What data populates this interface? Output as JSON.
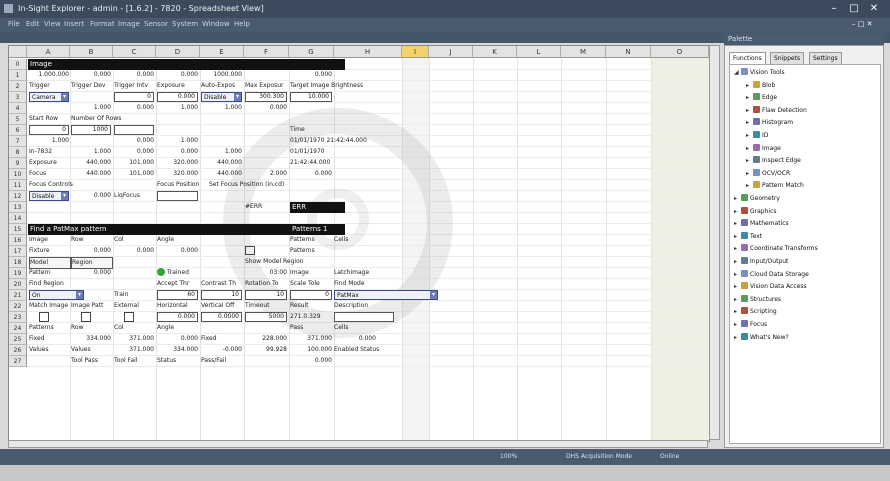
{
  "window": {
    "title": "In-Sight Explorer - admin - [1.6.2] - 7820 - Spreadsheet View]",
    "controls": [
      "–",
      "□",
      "✕"
    ]
  },
  "menu": [
    "File",
    "Edit",
    "View",
    "Insert",
    "Format",
    "Image",
    "Sensor",
    "System",
    "Window",
    "Help"
  ],
  "columns": [
    "A",
    "B",
    "C",
    "D",
    "E",
    "F",
    "G",
    "H",
    "I",
    "J",
    "K",
    "L",
    "M",
    "N",
    "O"
  ],
  "rows": [
    "0",
    "1",
    "2",
    "3",
    "4",
    "5",
    "6",
    "7",
    "8",
    "9",
    "10",
    "11",
    "12",
    "13",
    "14",
    "15",
    "16",
    "17",
    "18",
    "19",
    "20",
    "21",
    "22",
    "23",
    "24",
    "25",
    "26",
    "27"
  ],
  "cells": {
    "r0_image": "Image",
    "r1": [
      "1.000.000",
      "0.000",
      "0.000",
      "0.000",
      "1000.000",
      "",
      "0.000"
    ],
    "r2": [
      "Trigger",
      "Trigger Dev",
      "Trigger Intv",
      "Exposure",
      "Auto-Expos",
      "Max Exposur",
      "Target Image Brightness"
    ],
    "r3_drop1": "Camera",
    "r3_drop2": "Disable",
    "r3_vals": [
      "0",
      "0.000",
      "0.000",
      "300.300",
      "10.000"
    ],
    "r4": [
      "1.000",
      "0.000",
      "1.000",
      "1.000",
      "0.000"
    ],
    "r5": [
      "Start Row",
      "Number Of Rows"
    ],
    "r5_time": "Time",
    "r6_vals": [
      "0",
      "1000"
    ],
    "r7": [
      "1.000",
      "",
      "0.000",
      "1.000"
    ],
    "r7_date": "01/01/1970 21:42:44.000",
    "r8": [
      "In-7832",
      "1.000",
      "0.000",
      "0.000",
      "1.000"
    ],
    "r8_date": "01/01/1970",
    "r9": [
      "Exposure",
      "440.000",
      "101.000",
      "320.000",
      "440.000"
    ],
    "r9_time": "21:42:44.000",
    "r10": [
      "Focus",
      "440.000",
      "101.000",
      "320.000",
      "440.000",
      "2.000",
      "0.000"
    ],
    "r11": [
      "Focus Controls",
      "Focus Position",
      "Set Focus Position (in.cd)"
    ],
    "r12_drop": "Disable",
    "r12_vals": [
      "0.000",
      "LiqFocus"
    ],
    "r13_err": "#ERR",
    "r13_err2": "ERR",
    "r15_bar": "Find a PatMax pattern",
    "r15_patterns": "Patterns 1",
    "r16": [
      "Image",
      "Row",
      "Col",
      "Angle",
      "Patterns",
      "Cells"
    ],
    "r17": [
      "Fixture",
      "0.000",
      "0.000",
      "0.000"
    ],
    "r17_patterns": "Patterns",
    "r18": [
      "Model",
      "Region"
    ],
    "r18_show": "Show Model Region",
    "r19": [
      "Pattern",
      "0.000"
    ],
    "r19_trained": "Trained",
    "r19_time": "03:00",
    "r19_image": "Image",
    "r19_latch": "Latchimage",
    "r20": [
      "Find Region",
      "Accept Thr",
      "Contrast Th",
      "Rotation To",
      "Scale Tole",
      "Find Mode"
    ],
    "r21_drop1": "On",
    "r21_train": "Train",
    "r21_vals": [
      "60",
      "10",
      "10",
      "0"
    ],
    "r21_mode": "PatMax",
    "r22": [
      "Match Image",
      "Image Patt",
      "External",
      "Horizontal",
      "Vertical Off",
      "Timeout",
      "Result",
      "Description"
    ],
    "r23_vals": [
      "0.000",
      "0.0000",
      "5000",
      "271.0.329"
    ],
    "r24": [
      "Patterns",
      "Row",
      "Col",
      "Angle",
      "Pass",
      "Cells"
    ],
    "r25": [
      "Fixed",
      "334.000",
      "371.000",
      "0.000",
      "Fixed",
      "228.000",
      "371.000",
      "0.000"
    ],
    "r26": [
      "Values",
      "Values",
      "371.000",
      "334.000",
      "-0.000",
      "99.928",
      "100.000",
      "Enabled Status"
    ],
    "r27": [
      "Tool Pass",
      "Tool Fail",
      "Status",
      "Pass/Fail",
      "",
      "0.000"
    ]
  },
  "panel": {
    "title": "Palette",
    "tabs": [
      "Functions",
      "Snippets",
      "Settings"
    ],
    "tree": [
      {
        "label": "Vision Tools",
        "level": 0,
        "expanded": true
      },
      {
        "label": "Blob",
        "level": 1
      },
      {
        "label": "Edge",
        "level": 1
      },
      {
        "label": "Flaw Detection",
        "level": 1
      },
      {
        "label": "Histogram",
        "level": 1
      },
      {
        "label": "ID",
        "level": 1
      },
      {
        "label": "Image",
        "level": 1
      },
      {
        "label": "Inspect Edge",
        "level": 1
      },
      {
        "label": "OCV/OCR",
        "level": 1
      },
      {
        "label": "Pattern Match",
        "level": 1
      },
      {
        "label": "Geometry",
        "level": 0
      },
      {
        "label": "Graphics",
        "level": 0
      },
      {
        "label": "Mathematics",
        "level": 0
      },
      {
        "label": "Text",
        "level": 0
      },
      {
        "label": "Coordinate Transforms",
        "level": 0
      },
      {
        "label": "Input/Output",
        "level": 0
      },
      {
        "label": "Cloud Data Storage",
        "level": 0
      },
      {
        "label": "Vision Data Access",
        "level": 0
      },
      {
        "label": "Structures",
        "level": 0
      },
      {
        "label": "Scripting",
        "level": 0
      },
      {
        "label": "Focus",
        "level": 0
      },
      {
        "label": "What's New?",
        "level": 0
      }
    ]
  },
  "status": {
    "zoom": "100%",
    "mode": "Online",
    "job": "DHS Acquisition Mode"
  }
}
